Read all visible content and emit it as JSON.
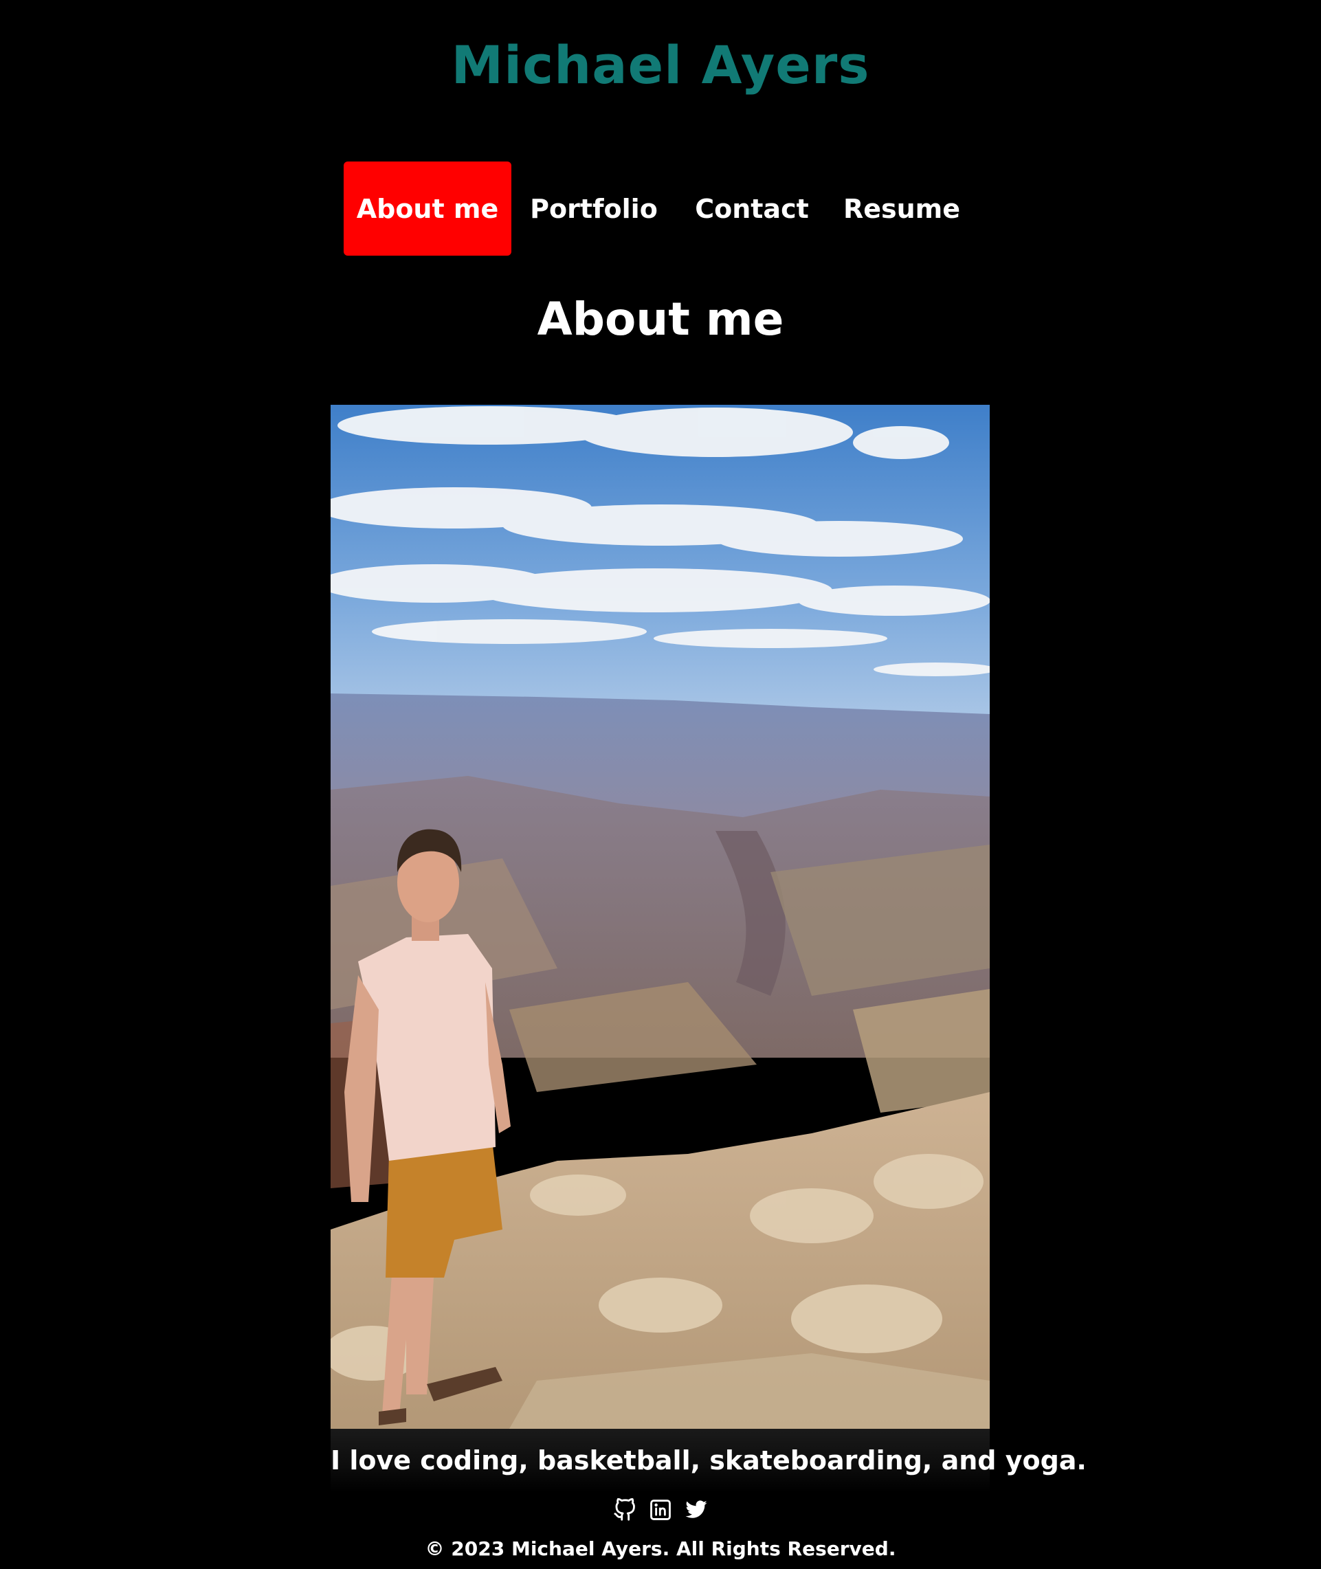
{
  "header": {
    "site_title": "Michael Ayers",
    "title_color": "#117a75"
  },
  "nav": {
    "items": [
      {
        "label": "About me",
        "active": true
      },
      {
        "label": "Portfolio",
        "active": false
      },
      {
        "label": "Contact",
        "active": false
      },
      {
        "label": "Resume",
        "active": false
      }
    ],
    "active_color": "#ff0000"
  },
  "main": {
    "heading": "About me",
    "bio": "I love coding, basketball, skateboarding, and yoga."
  },
  "footer": {
    "social": [
      {
        "icon": "github-icon"
      },
      {
        "icon": "linkedin-icon"
      },
      {
        "icon": "twitter-icon"
      }
    ],
    "copyright": "© 2023 Michael Ayers. All Rights Reserved."
  }
}
